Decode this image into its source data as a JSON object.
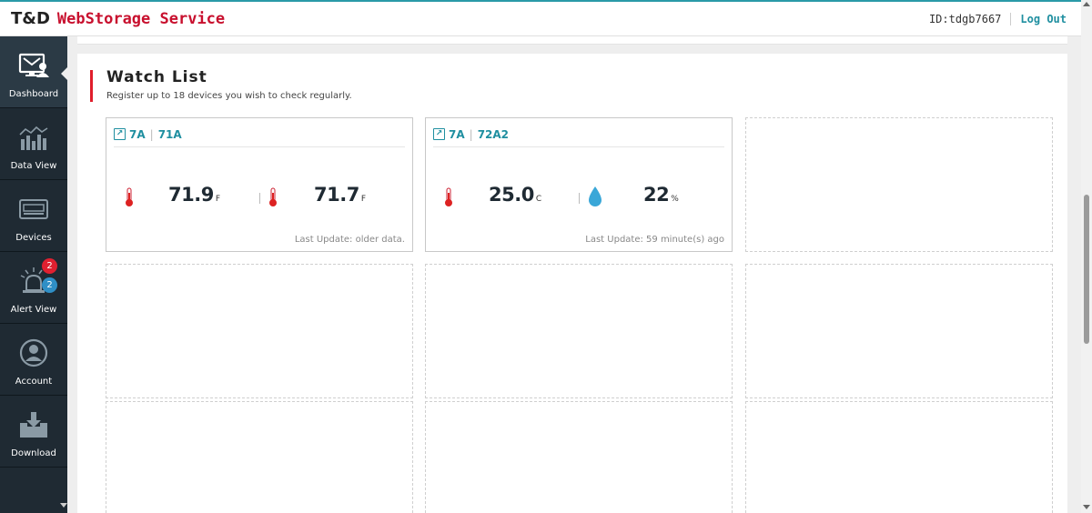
{
  "header": {
    "brand_main": "T&D",
    "brand_service": "WebStorage Service",
    "user_id": "ID:tdgb7667",
    "logout_label": "Log Out"
  },
  "sidebar": {
    "items": [
      {
        "label": "Dashboard",
        "icon": "dashboard-icon",
        "active": true
      },
      {
        "label": "Data View",
        "icon": "bar-chart-icon"
      },
      {
        "label": "Devices",
        "icon": "device-icon"
      },
      {
        "label": "Alert View",
        "icon": "alert-bell-icon",
        "badge_red": "2",
        "badge_blue": "2"
      },
      {
        "label": "Account",
        "icon": "user-icon"
      },
      {
        "label": "Download",
        "icon": "download-icon"
      }
    ]
  },
  "watchlist": {
    "title": "Watch List",
    "subtitle": "Register up to 18 devices you wish to check regularly.",
    "cards": [
      {
        "group": "7A",
        "device": "71A",
        "reading1": {
          "value": "71.9",
          "unit": "F",
          "type": "temperature"
        },
        "reading2": {
          "value": "71.7",
          "unit": "F",
          "type": "temperature"
        },
        "last_update": "Last Update: older data."
      },
      {
        "group": "7A",
        "device": "72A2",
        "reading1": {
          "value": "25.0",
          "unit": "C",
          "type": "temperature"
        },
        "reading2": {
          "value": "22",
          "unit": "%",
          "type": "humidity"
        },
        "last_update": "Last Update: 59 minute(s) ago"
      }
    ]
  },
  "colors": {
    "accent": "#1f8fa0",
    "brand_red": "#c8102e",
    "sidebar_bg": "#1f2a33",
    "badge_red": "#e02030",
    "badge_blue": "#2f8fc6"
  }
}
